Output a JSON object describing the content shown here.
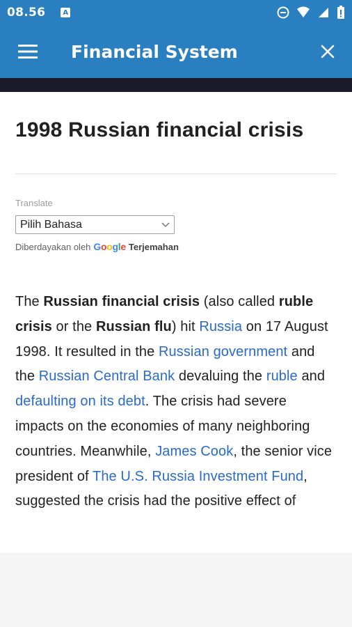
{
  "status_bar": {
    "time": "08.56",
    "notification_badge": "A",
    "icons": [
      "do-not-disturb-icon",
      "wifi-icon",
      "signal-icon",
      "battery-icon"
    ]
  },
  "app_bar": {
    "title": "Financial System",
    "menu_icon": "hamburger-icon",
    "close_icon": "close-icon"
  },
  "article": {
    "title": "1998 Russian financial crisis",
    "translate": {
      "label": "Translate",
      "selected_language": "Pilih Bahasa",
      "powered_by": "Diberdayakan oleh",
      "google": "Google",
      "translate_link": "Terjemahan"
    },
    "paragraph": {
      "t1": "The ",
      "b1": "Russian financial crisis",
      "t2": " (also called ",
      "b2": "ruble crisis",
      "t3": " or the ",
      "b3": "Russian flu",
      "t4": ") hit ",
      "l1": "Russia",
      "t5": " on 17 August 1998. It resulted in the ",
      "l2": "Russian government",
      "t6": " and the ",
      "l3": "Russian Central Bank",
      "t7": " devaluing the ",
      "l4": "ruble",
      "t8": " and ",
      "l5": "defaulting on its debt",
      "t9": ". The crisis had severe impacts on the economies of many neighboring countries. Meanwhile, ",
      "l6": "James Cook",
      "t10": ", the senior vice president of ",
      "l7": "The U.S. Russia Investment Fund",
      "t11": ", suggested the crisis had the positive effect of"
    }
  },
  "colors": {
    "app_bar": "#2a7fc0",
    "dark_strip": "#1b1b2b",
    "link": "#2a6ac9"
  }
}
